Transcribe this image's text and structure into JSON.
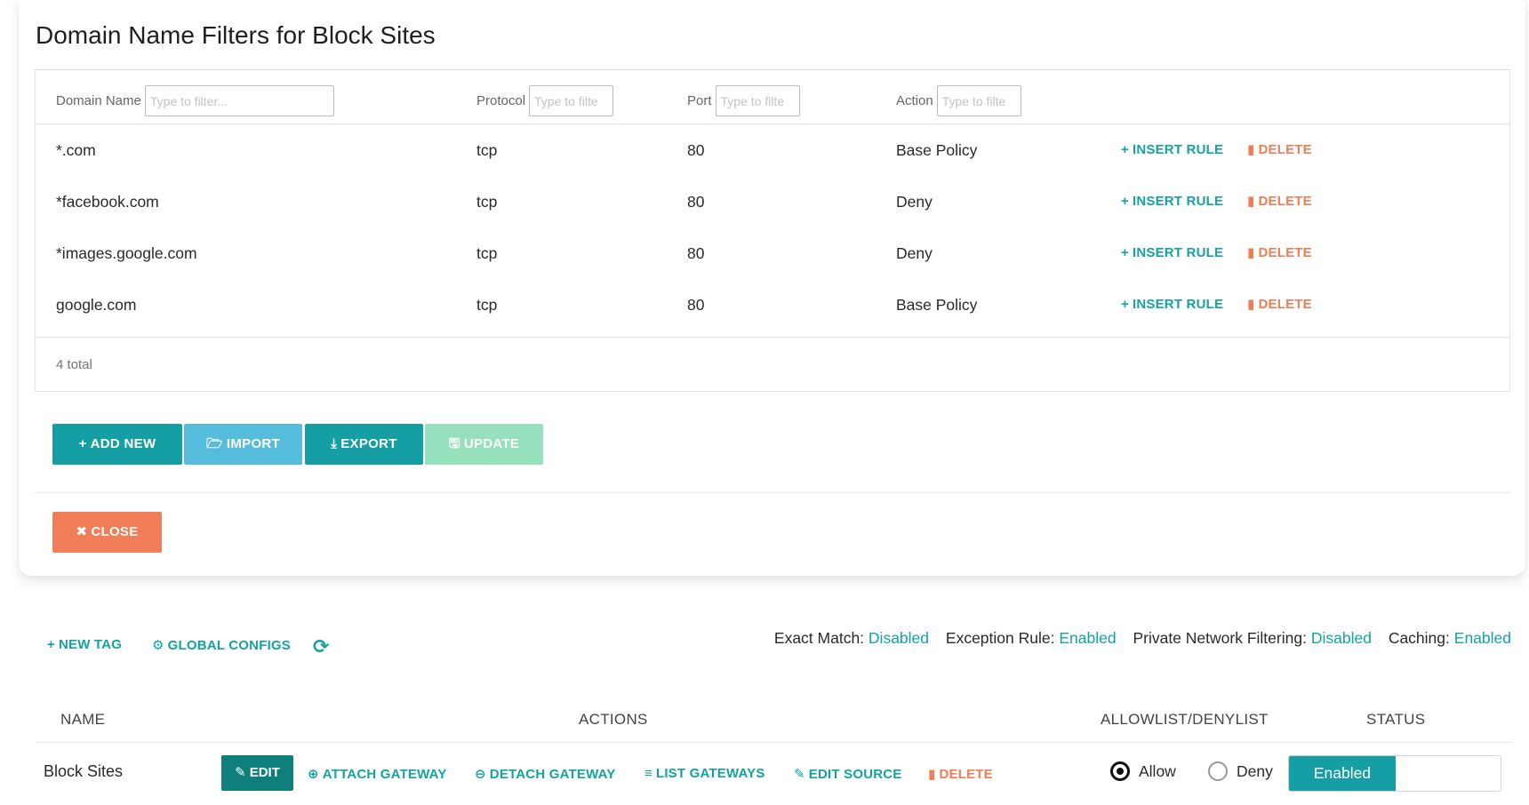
{
  "modal": {
    "title": "Domain Name Filters for Block Sites",
    "filters": {
      "domain_label": "Domain Name",
      "domain_placeholder": "Type to filter...",
      "protocol_label": "Protocol",
      "protocol_placeholder": "Type to filte",
      "port_label": "Port",
      "port_placeholder": "Type to filte",
      "action_label": "Action",
      "action_placeholder": "Type to filte"
    },
    "rows": [
      {
        "domain": "*.com",
        "protocol": "tcp",
        "port": "80",
        "action": "Base Policy",
        "insert": "INSERT RULE",
        "delete": "DELETE"
      },
      {
        "domain": "*facebook.com",
        "protocol": "tcp",
        "port": "80",
        "action": "Deny",
        "insert": "INSERT RULE",
        "delete": "DELETE"
      },
      {
        "domain": "*images.google.com",
        "protocol": "tcp",
        "port": "80",
        "action": "Deny",
        "insert": "INSERT RULE",
        "delete": "DELETE"
      },
      {
        "domain": "google.com",
        "protocol": "tcp",
        "port": "80",
        "action": "Base Policy",
        "insert": "INSERT RULE",
        "delete": "DELETE"
      }
    ],
    "total": "4 total",
    "buttons": {
      "add_new": "ADD NEW",
      "import": "IMPORT",
      "export": "EXPORT",
      "update": "UPDATE",
      "close": "CLOSE"
    }
  },
  "toolbar": {
    "new_tag": "NEW TAG",
    "global_configs": "GLOBAL CONFIGS",
    "refresh_icon": "refresh-icon"
  },
  "settings": {
    "exact_match_label": "Exact Match:",
    "exact_match_value": "Disabled",
    "exception_rule_label": "Exception Rule:",
    "exception_rule_value": "Enabled",
    "private_network_label": "Private Network Filtering:",
    "private_network_value": "Disabled",
    "caching_label": "Caching:",
    "caching_value": "Enabled"
  },
  "tags_table": {
    "headers": {
      "name": "NAME",
      "actions": "ACTIONS",
      "list": "ALLOWLIST/DENYLIST",
      "status": "STATUS"
    },
    "rows": [
      {
        "name": "Block Sites",
        "edit": "EDIT",
        "attach": "ATTACH GATEWAY",
        "detach": "DETACH GATEWAY",
        "list_gateways": "LIST GATEWAYS",
        "edit_source": "EDIT SOURCE",
        "delete": "DELETE",
        "allow": "Allow",
        "deny": "Deny",
        "selected": "Allow",
        "status": "Enabled"
      }
    ]
  },
  "colors": {
    "teal": "#14a3a3",
    "orange": "#f17e58",
    "light_blue": "#55bcdb",
    "mint": "#97e0bd",
    "dark_teal": "#0f7f7d"
  }
}
